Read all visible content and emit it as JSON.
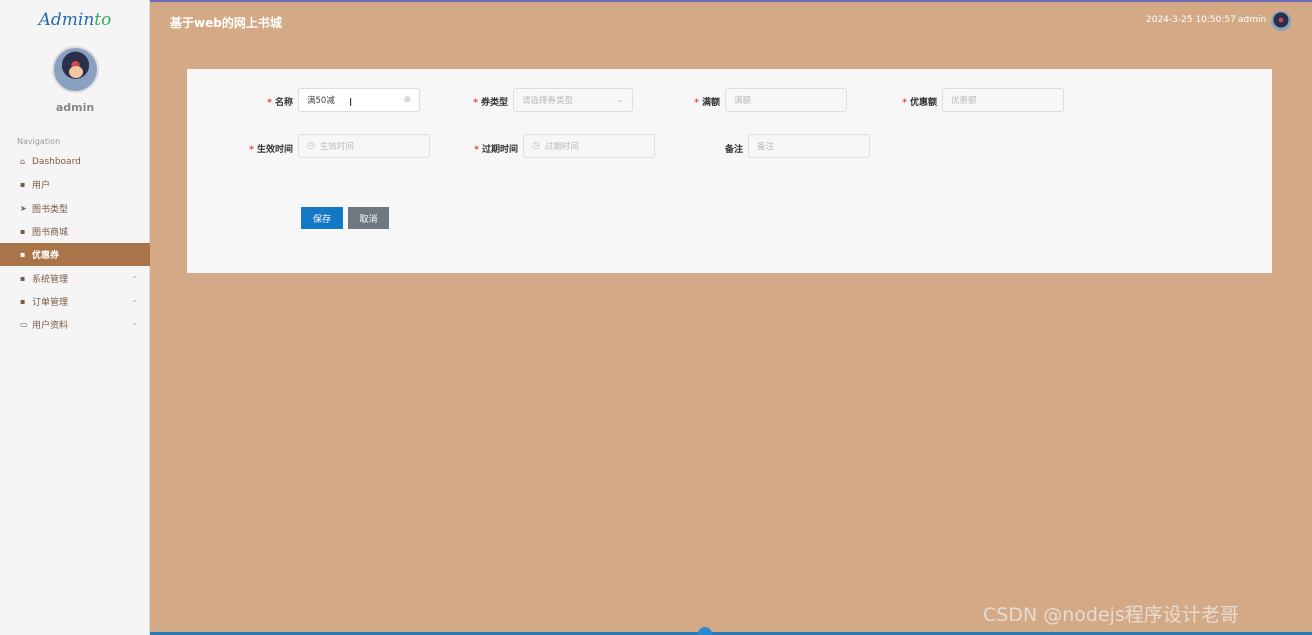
{
  "sidebar": {
    "logo_main": "Admin",
    "logo_accent": "to",
    "username": "admin",
    "nav_heading": "Navigation",
    "items": [
      {
        "label": "Dashboard",
        "icon": "home-icon",
        "glyph": "⌂"
      },
      {
        "label": "用户",
        "icon": "grid-icon",
        "glyph": "▪"
      },
      {
        "label": "图书类型",
        "icon": "send-icon",
        "glyph": "➤"
      },
      {
        "label": "图书商城",
        "icon": "grid-icon",
        "glyph": "▪"
      },
      {
        "label": "优惠券",
        "icon": "grid-icon",
        "glyph": "▪"
      },
      {
        "label": "系统管理",
        "icon": "grid-icon",
        "glyph": "▪"
      },
      {
        "label": "订单管理",
        "icon": "grid-icon",
        "glyph": "▪"
      },
      {
        "label": "用户资料",
        "icon": "card-icon",
        "glyph": "▭"
      }
    ]
  },
  "topbar": {
    "title": "基于web的网上书城",
    "datetime": "2024-3-25 10:50:57",
    "user": "admin"
  },
  "form": {
    "name": {
      "label": "名称",
      "value": "满50减"
    },
    "coupon_type": {
      "label": "券类型",
      "placeholder": "请选择券类型"
    },
    "full_amount": {
      "label": "满额",
      "placeholder": "满额"
    },
    "discount": {
      "label": "优惠额",
      "placeholder": "优惠额"
    },
    "start_time": {
      "label": "生效时间",
      "placeholder": "生效时间"
    },
    "end_time": {
      "label": "过期时间",
      "placeholder": "过期时间"
    },
    "remark": {
      "label": "备注",
      "placeholder": "备注"
    },
    "save_label": "保存",
    "cancel_label": "取消"
  },
  "watermark": "CSDN @nodejs程序设计老哥",
  "colors": {
    "background": "#d4aa86",
    "active_nav": "#a97447",
    "save_button": "#1478c4",
    "cancel_button": "#6f7880"
  }
}
